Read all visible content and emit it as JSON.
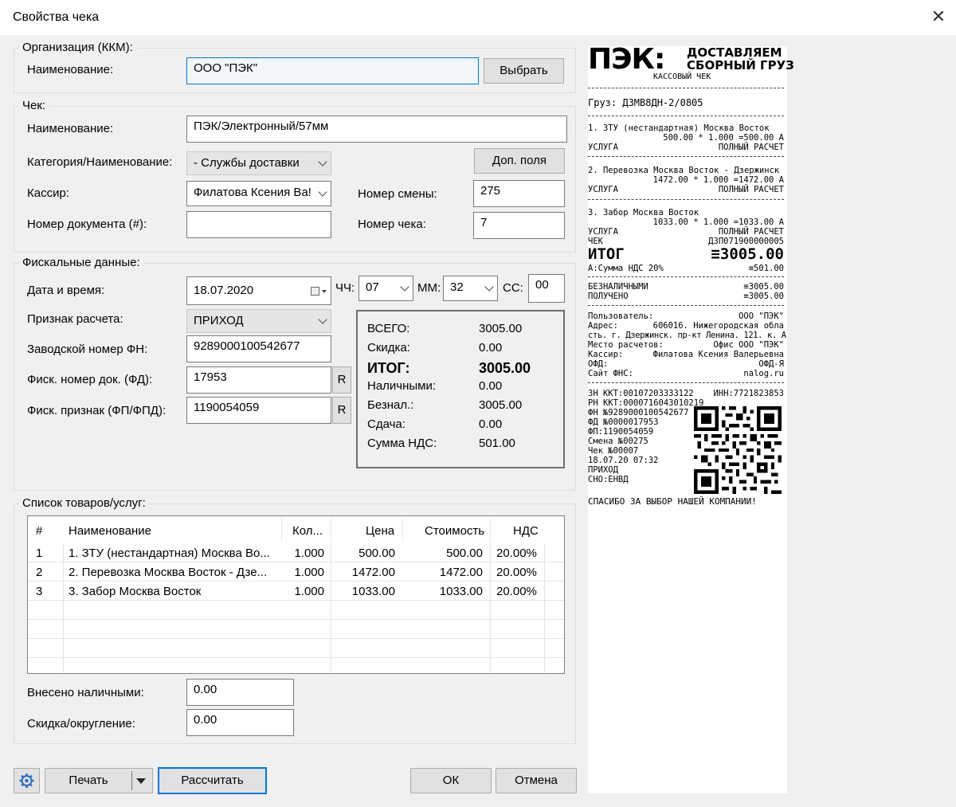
{
  "window": {
    "title": "Свойства чека",
    "close_glyph": "✕"
  },
  "org": {
    "group_label": "Организация (ККМ):",
    "name_label": "Наименование:",
    "name_value": "ООО \"ПЭК\"",
    "choose_button": "Выбрать"
  },
  "check": {
    "group_label": "Чек:",
    "name_label": "Наименование:",
    "name_value": "ПЭК/Электронный/57мм",
    "category_label": "Категория/Наименование:",
    "category_value": "- Службы доставки",
    "extra_fields_button": "Доп. поля",
    "cashier_label": "Кассир:",
    "cashier_value": "Филатова Ксения Ва!",
    "shift_label": "Номер смены:",
    "shift_value": "275",
    "docnum_label": "Номер документа (#):",
    "docnum_value": "",
    "checknum_label": "Номер чека:",
    "checknum_value": "7"
  },
  "fiscal": {
    "group_label": "Фискальные данные:",
    "datetime_label": "Дата и время:",
    "date_value": "18.07.2020",
    "hh_label": "ЧЧ:",
    "hh_value": "07",
    "mm_label": "ММ:",
    "mm_value": "32",
    "ss_label": "СС:",
    "ss_value": "00",
    "sign_label": "Признак расчета:",
    "sign_value": "ПРИХОД",
    "fn_label": "Заводской номер ФН:",
    "fn_value": "9289000100542677",
    "fd_label": "Фиск. номер док. (ФД):",
    "fd_value": "17953",
    "fp_label": "Фиск. признак (ФП/ФПД):",
    "fp_value": "1190054059",
    "r_button": "R"
  },
  "totals": {
    "total_label": "ВСЕГО:",
    "total_value": "3005.00",
    "discount_label": "Скидка:",
    "discount_value": "0.00",
    "itog_label": "ИТОГ:",
    "itog_value": "3005.00",
    "cash_label": "Наличными:",
    "cash_value": "0.00",
    "card_label": "Безнал.:",
    "card_value": "3005.00",
    "change_label": "Сдача:",
    "change_value": "0.00",
    "vat_label": "Сумма НДС:",
    "vat_value": "501.00"
  },
  "goods": {
    "group_label": "Список товаров/услуг:",
    "headers": [
      "#",
      "Наименование",
      "Кол...",
      "Цена",
      "Стоимость",
      "НДС"
    ],
    "rows": [
      [
        "1",
        "1. ЗТУ (нестандартная) Москва Во...",
        "1.000",
        "500.00",
        "500.00",
        "20.00%"
      ],
      [
        "2",
        "2. Перевозка Москва Восток - Дзе...",
        "1.000",
        "1472.00",
        "1472.00",
        "20.00%"
      ],
      [
        "3",
        "3. Забор Москва Восток",
        "1.000",
        "1033.00",
        "1033.00",
        "20.00%"
      ]
    ],
    "cash_in_label": "Внесено наличными:",
    "cash_in_value": "0.00",
    "rounding_label": "Скидка/округление:",
    "rounding_value": "0.00"
  },
  "footer": {
    "settings_icon": "gear-icon",
    "print_button": "Печать",
    "calc_button": "Рассчитать",
    "ok_button": "ОК",
    "cancel_button": "Отмена"
  },
  "receipt": {
    "logo": "ПЭК:",
    "slogan1": "ДОСТАВЛЯЕМ",
    "slogan2": "СБОРНЫЙ ГРУЗ",
    "subtitle": "КАССОВЫЙ ЧЕК",
    "cargo": "Груз: ДЗМВ8ДН-2/0805",
    "item1_name": "1. ЗТУ (нестандартная) Москва Восток",
    "item1_calc": "500.00 * 1.000 =500.00 А",
    "item1_type": "УСЛУГА",
    "item1_pay": "ПОЛНЫЙ РАСЧЕТ",
    "item2_name": "2. Перевозка Москва Восток - Дзержинск",
    "item2_calc": "1472.00 * 1.000 =1472.00 А",
    "item2_type": "УСЛУГА",
    "item2_pay": "ПОЛНЫЙ РАСЧЕТ",
    "item3_name": "3. Забор Москва Восток",
    "item3_calc": "1033.00 * 1.000 =1033.00 А",
    "item3_type": "УСЛУГА",
    "item3_pay": "ПОЛНЫЙ РАСЧЕТ",
    "check_label": "ЧЕК",
    "check_code": "ДЗП071900000005",
    "itog_label": "ИТОГ",
    "itog_value": "≡3005.00",
    "vat_label": "А:Сумма НДС 20%",
    "vat_value": "≡501.00",
    "noncash_label": "БЕЗНАЛИЧНЫМИ",
    "noncash_value": "≡3005.00",
    "received_label": "ПОЛУЧЕНО",
    "received_value": "≡3005.00",
    "user_label": "Пользователь:",
    "user_value": "ООО \"ПЭК\"",
    "addr_label": "Адрес:",
    "addr_value1": "606016. Нижегородская обла",
    "addr_value2": "сть. г. Дзержинск. пр-кт Ленина. 121. к. А",
    "place_label": "Место расчетов:",
    "place_value": "Офис ООО \"ПЭК\"",
    "cashier_label": "Кассир:",
    "cashier_value": "Филатова Ксения Валерьевна",
    "ofd_label": "ОФД:",
    "ofd_value": "ОФД-Я",
    "fns_label": "Сайт ФНС:",
    "fns_value": "nalog.ru",
    "zn": "ЗН ККТ:00107203333122",
    "inn": "ИНН:7721823853",
    "rn": "РН ККТ:0000716043010219",
    "fn": "ФН №9289000100542677",
    "fd": "ФД №0000017953",
    "fp": "ФП:1190054059",
    "shift": "Смена №00275",
    "checkno": "Чек №00007",
    "datetime": "18.07.20 07:32",
    "sign": "ПРИХОД",
    "sno": "СНО:ЕНВД",
    "thanks": "СПАСИБО ЗА ВЫБОР НАШЕЙ КОМПАНИИ!"
  }
}
